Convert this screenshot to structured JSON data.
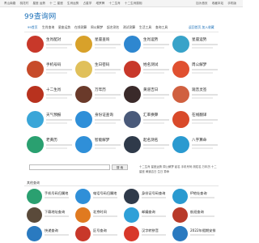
{
  "topbar": {
    "links": [
      "青山南路",
      "桃花村",
      "星座 运势",
      "十 二 星座",
      "生肖运势",
      "占星学",
      "塔罗牌",
      "十二生肖",
      "十二生肖属相"
    ],
    "right": [
      "加为首页",
      "收藏本站",
      "手机版"
    ]
  },
  "site": {
    "logo": "99查询网"
  },
  "nav": {
    "items": [
      "99首页",
      "生肖查询",
      "星座运势",
      "在线测算",
      "周公解梦",
      "起名测名",
      "测试测算",
      "生活工具",
      "查询工具"
    ],
    "right_link": "返回首页 加入收藏"
  },
  "colors": {
    "brand": "#1a6fb8",
    "pics": [
      "#c8382a",
      "#d8a12a",
      "#2e87d0",
      "#38a3c9",
      "#c74b2a",
      "#e0c05a",
      "#c8382a",
      "#e05030",
      "#b8321e",
      "#6a3a2a",
      "#3a2a2a",
      "#d06040",
      "#3aa6d8",
      "#2f8fd8",
      "#4a5a7a",
      "#d94a2a",
      "#2aa070",
      "#2f8fd8",
      "#2f3a4a",
      "#2a9ad0",
      "#5a4a3a",
      "#e07a20",
      "#2fa0d8",
      "#b83a2a",
      "#2a7ac0",
      "#c8382a",
      "#d8382a",
      "#2a7ac0"
    ]
  },
  "cards": [
    {
      "title": "生肖配对"
    },
    {
      "title": "星座查询"
    },
    {
      "title": "生肖运势"
    },
    {
      "title": "星座运势"
    },
    {
      "title": "手机号码"
    },
    {
      "title": "生日密码"
    },
    {
      "title": "姓名测试"
    },
    {
      "title": "周公解梦"
    },
    {
      "title": "十二生肖"
    },
    {
      "title": "万年历"
    },
    {
      "title": "黄道吉日"
    },
    {
      "title": "观音灵签"
    },
    {
      "title": "天气预报"
    },
    {
      "title": "身份证查询"
    },
    {
      "title": "汇率换算"
    },
    {
      "title": "在线翻译"
    },
    {
      "title": "老黄历"
    },
    {
      "title": "智能解梦"
    },
    {
      "title": "起名测名"
    },
    {
      "title": "八字算命"
    }
  ],
  "search": {
    "placeholder": "",
    "button": "搜 索",
    "links": "十二生肖 星座运势 周公解梦 起名 手机号码 测姓名 万年历 十二星座 黄道吉日 生日 算命"
  },
  "section": {
    "title": "其他查询"
  },
  "cards2": [
    {
      "title": "手机号码归属地"
    },
    {
      "title": "电话号码归属地"
    },
    {
      "title": "身份证号码查询"
    },
    {
      "title": "IP地址查询"
    },
    {
      "title": "下载地址查询"
    },
    {
      "title": "北京时间"
    },
    {
      "title": "邮编查询"
    },
    {
      "title": "航班查询"
    },
    {
      "title": "快递查询"
    },
    {
      "title": "区号查询"
    },
    {
      "title": "汉字转拼音"
    },
    {
      "title": "2022年假期安排"
    }
  ]
}
